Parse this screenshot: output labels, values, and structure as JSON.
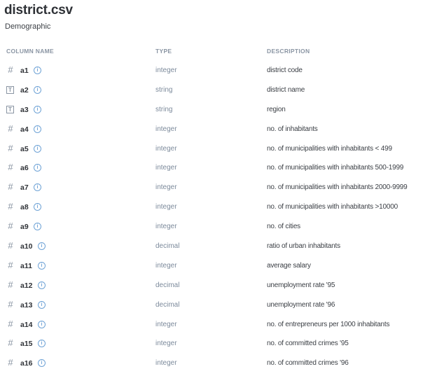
{
  "file": {
    "title": "district.csv",
    "subtitle": "Demographic"
  },
  "columns_header": {
    "name": "COLUMN NAME",
    "type": "TYPE",
    "description": "DESCRIPTION"
  },
  "rows": [
    {
      "name": "a1",
      "type": "integer",
      "description": "district code",
      "icon": "hash-icon"
    },
    {
      "name": "a2",
      "type": "string",
      "description": "district name",
      "icon": "text-icon"
    },
    {
      "name": "a3",
      "type": "string",
      "description": "region",
      "icon": "text-icon"
    },
    {
      "name": "a4",
      "type": "integer",
      "description": "no. of inhabitants",
      "icon": "hash-icon"
    },
    {
      "name": "a5",
      "type": "integer",
      "description": "no. of municipalities with inhabitants < 499",
      "icon": "hash-icon"
    },
    {
      "name": "a6",
      "type": "integer",
      "description": "no. of municipalities with inhabitants 500-1999",
      "icon": "hash-icon"
    },
    {
      "name": "a7",
      "type": "integer",
      "description": "no. of municipalities with inhabitants 2000-9999",
      "icon": "hash-icon"
    },
    {
      "name": "a8",
      "type": "integer",
      "description": "no. of municipalities with inhabitants >10000",
      "icon": "hash-icon"
    },
    {
      "name": "a9",
      "type": "integer",
      "description": "no. of cities",
      "icon": "hash-icon"
    },
    {
      "name": "a10",
      "type": "decimal",
      "description": "ratio of urban inhabitants",
      "icon": "hash-icon"
    },
    {
      "name": "a11",
      "type": "integer",
      "description": "average salary",
      "icon": "hash-icon"
    },
    {
      "name": "a12",
      "type": "decimal",
      "description": "unemployment rate '95",
      "icon": "hash-icon"
    },
    {
      "name": "a13",
      "type": "decimal",
      "description": "unemployment rate '96",
      "icon": "hash-icon"
    },
    {
      "name": "a14",
      "type": "integer",
      "description": "no. of entrepreneurs per 1000 inhabitants",
      "icon": "hash-icon"
    },
    {
      "name": "a15",
      "type": "integer",
      "description": "no. of committed crimes '95",
      "icon": "hash-icon"
    },
    {
      "name": "a16",
      "type": "integer",
      "description": "no. of committed crimes '96",
      "icon": "hash-icon"
    }
  ],
  "icons": {
    "hash_glyph": "#",
    "text_glyph": "T",
    "info_glyph": "i"
  },
  "colors": {
    "accent_info": "#6fa3d6",
    "muted": "#8a95a3"
  }
}
